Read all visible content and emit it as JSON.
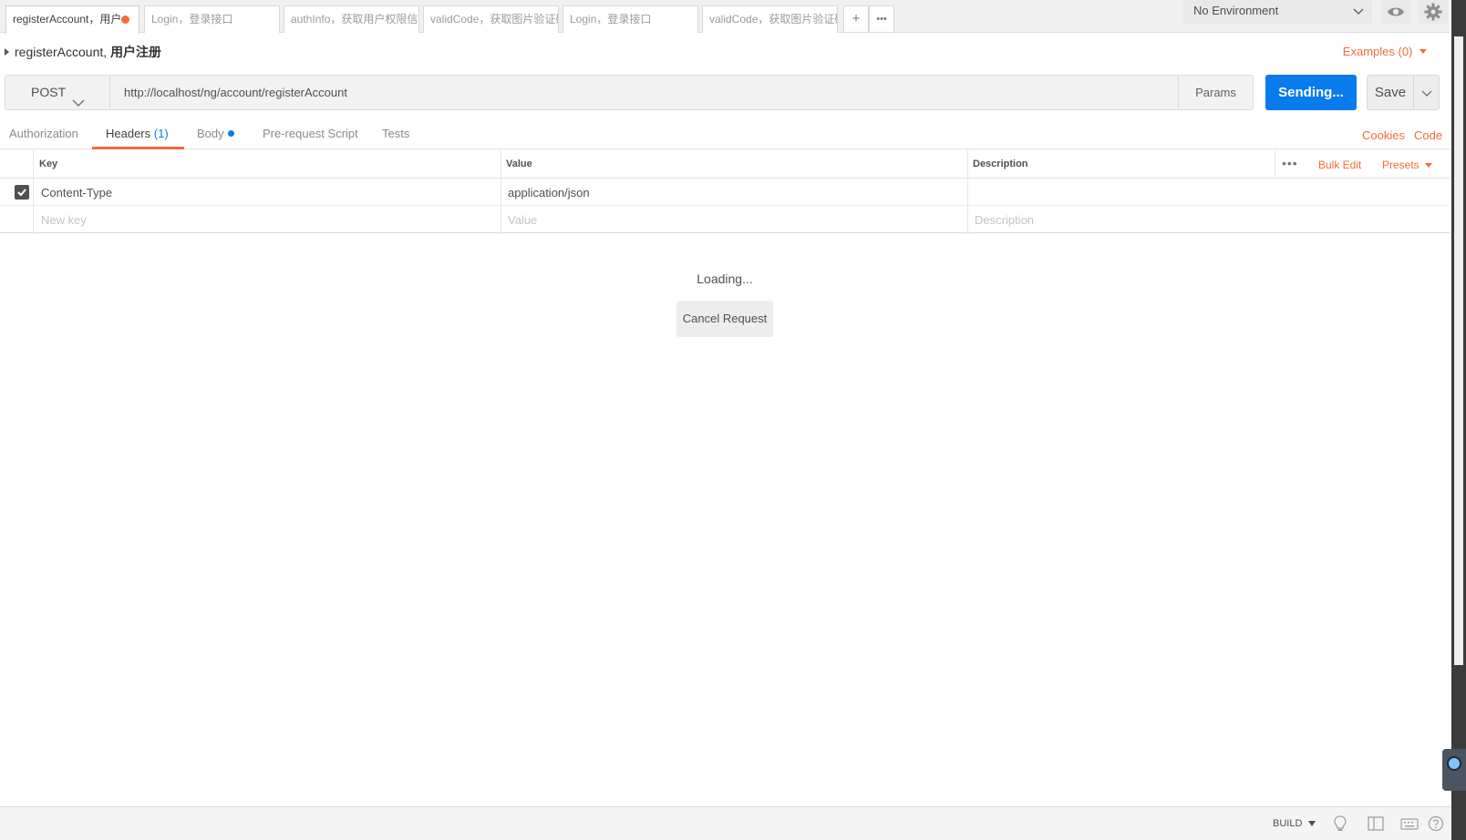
{
  "tabs": [
    {
      "label": "registerAccount，用户",
      "unsaved": true
    },
    {
      "label": "Login，登录接口"
    },
    {
      "label": "authInfo，获取用户权限信息"
    },
    {
      "label": "validCode，获取图片验证码"
    },
    {
      "label": "Login，登录接口"
    },
    {
      "label": "validCode，获取图片验证码"
    }
  ],
  "tab_actions": {
    "add": "+",
    "more": "•••"
  },
  "environment": {
    "selected": "No Environment"
  },
  "request": {
    "name": "registerAccount",
    "separator": ",",
    "description": "用户注册",
    "examples": "Examples (0)",
    "method": "POST",
    "url": "http://localhost/ng/account/registerAccount",
    "params_label": "Params",
    "send_label": "Sending...",
    "save_label": "Save"
  },
  "subtabs": {
    "authorization": "Authorization",
    "headers": "Headers",
    "headers_count": "(1)",
    "body": "Body",
    "prerequest": "Pre-request Script",
    "tests": "Tests",
    "cookies": "Cookies",
    "code": "Code"
  },
  "headers_table": {
    "columns": {
      "key": "Key",
      "value": "Value",
      "description": "Description"
    },
    "bulk_edit": "Bulk Edit",
    "presets": "Presets",
    "more": "•••",
    "rows": [
      {
        "checked": true,
        "key": "Content-Type",
        "value": "application/json",
        "description": ""
      }
    ],
    "new_row": {
      "key_placeholder": "New key",
      "value_placeholder": "Value",
      "description_placeholder": "Description"
    }
  },
  "response": {
    "loading_text": "Loading...",
    "cancel_label": "Cancel Request"
  },
  "statusbar": {
    "build_label": "BUILD"
  },
  "colors": {
    "accent": "#f26b3a",
    "primary": "#097bed"
  },
  "icons": [
    "eye-icon",
    "gear-icon",
    "chevron-down-icon",
    "check-icon",
    "lightbulb-icon",
    "two-pane-icon",
    "keyboard-icon",
    "help-icon"
  ]
}
